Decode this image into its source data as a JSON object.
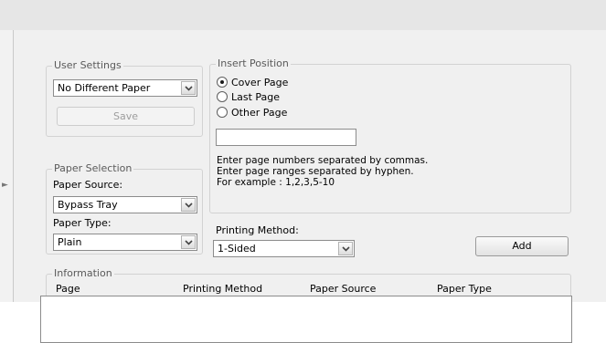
{
  "user_settings": {
    "legend": "User Settings",
    "paper_value": "No Different Paper",
    "save_label": "Save"
  },
  "insert_position": {
    "legend": "Insert Position",
    "options": [
      "Cover Page",
      "Last Page",
      "Other Page"
    ],
    "selected": "Cover Page",
    "page_input_value": "",
    "hint_lines": [
      "Enter page numbers separated by commas.",
      "Enter page ranges separated by hyphen.",
      "For example :  1,2,3,5-10"
    ]
  },
  "paper_selection": {
    "legend": "Paper Selection",
    "source_label": "Paper Source:",
    "source_value": "Bypass Tray",
    "type_label": "Paper Type:",
    "type_value": "Plain"
  },
  "printing_method": {
    "label": "Printing Method:",
    "value": "1-Sided"
  },
  "add_label": "Add",
  "information": {
    "legend": "Information",
    "columns": [
      "Page",
      "Printing Method",
      "Paper Source",
      "Paper Type"
    ]
  }
}
